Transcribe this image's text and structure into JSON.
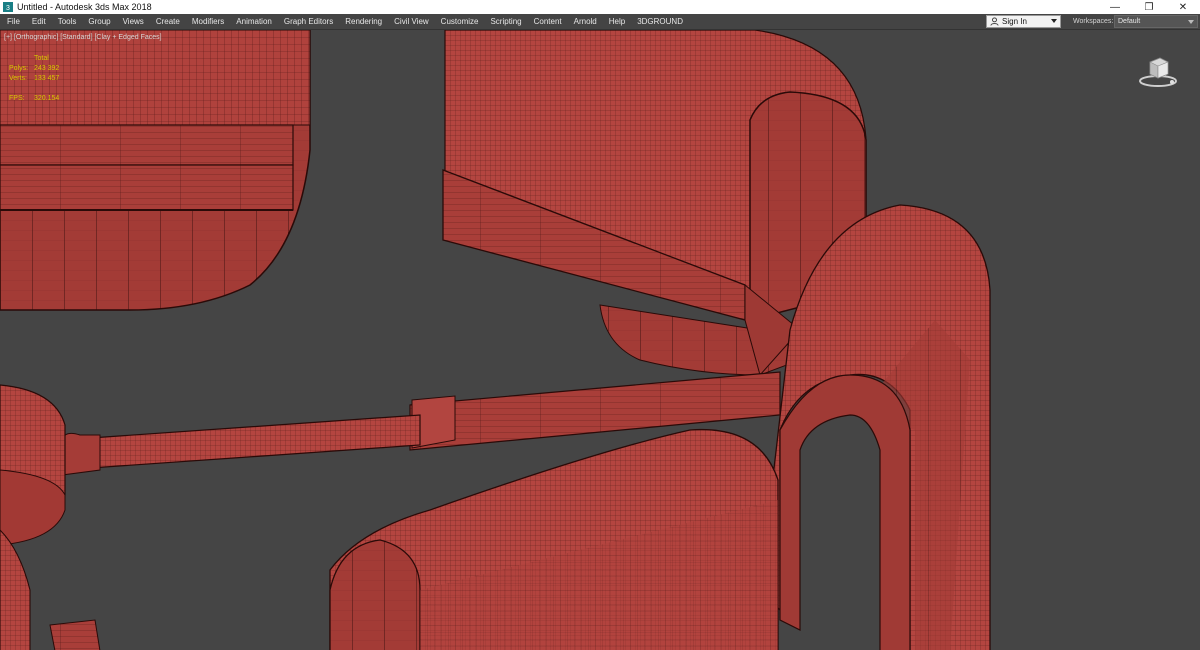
{
  "window": {
    "title": "Untitled - Autodesk 3ds Max 2018",
    "minimize_glyph": "—",
    "restore_glyph": "❐",
    "close_glyph": "✕",
    "app_icon": "3ds-max-icon"
  },
  "menubar": {
    "items": [
      "File",
      "Edit",
      "Tools",
      "Group",
      "Views",
      "Create",
      "Modifiers",
      "Animation",
      "Graph Editors",
      "Rendering",
      "Civil View",
      "Customize",
      "Scripting",
      "Content",
      "Arnold",
      "Help",
      "3DGROUND"
    ],
    "sign_in": "Sign In",
    "workspaces_label": "Workspaces:",
    "workspace_value": "Default"
  },
  "viewport": {
    "label": "[+] [Orthographic] [Standard] [Clay + Edged Faces]",
    "stats": {
      "header": "Total",
      "polys_label": "Polys:",
      "polys_value": "243 392",
      "verts_label": "Verts:",
      "verts_value": "133 457",
      "fps_label": "FPS:",
      "fps_value": "320.154"
    },
    "colors": {
      "background": "#454545",
      "mesh_fill": "#b0423d",
      "mesh_wire": "#3a0f0d",
      "stats_text": "#d6c800"
    }
  }
}
